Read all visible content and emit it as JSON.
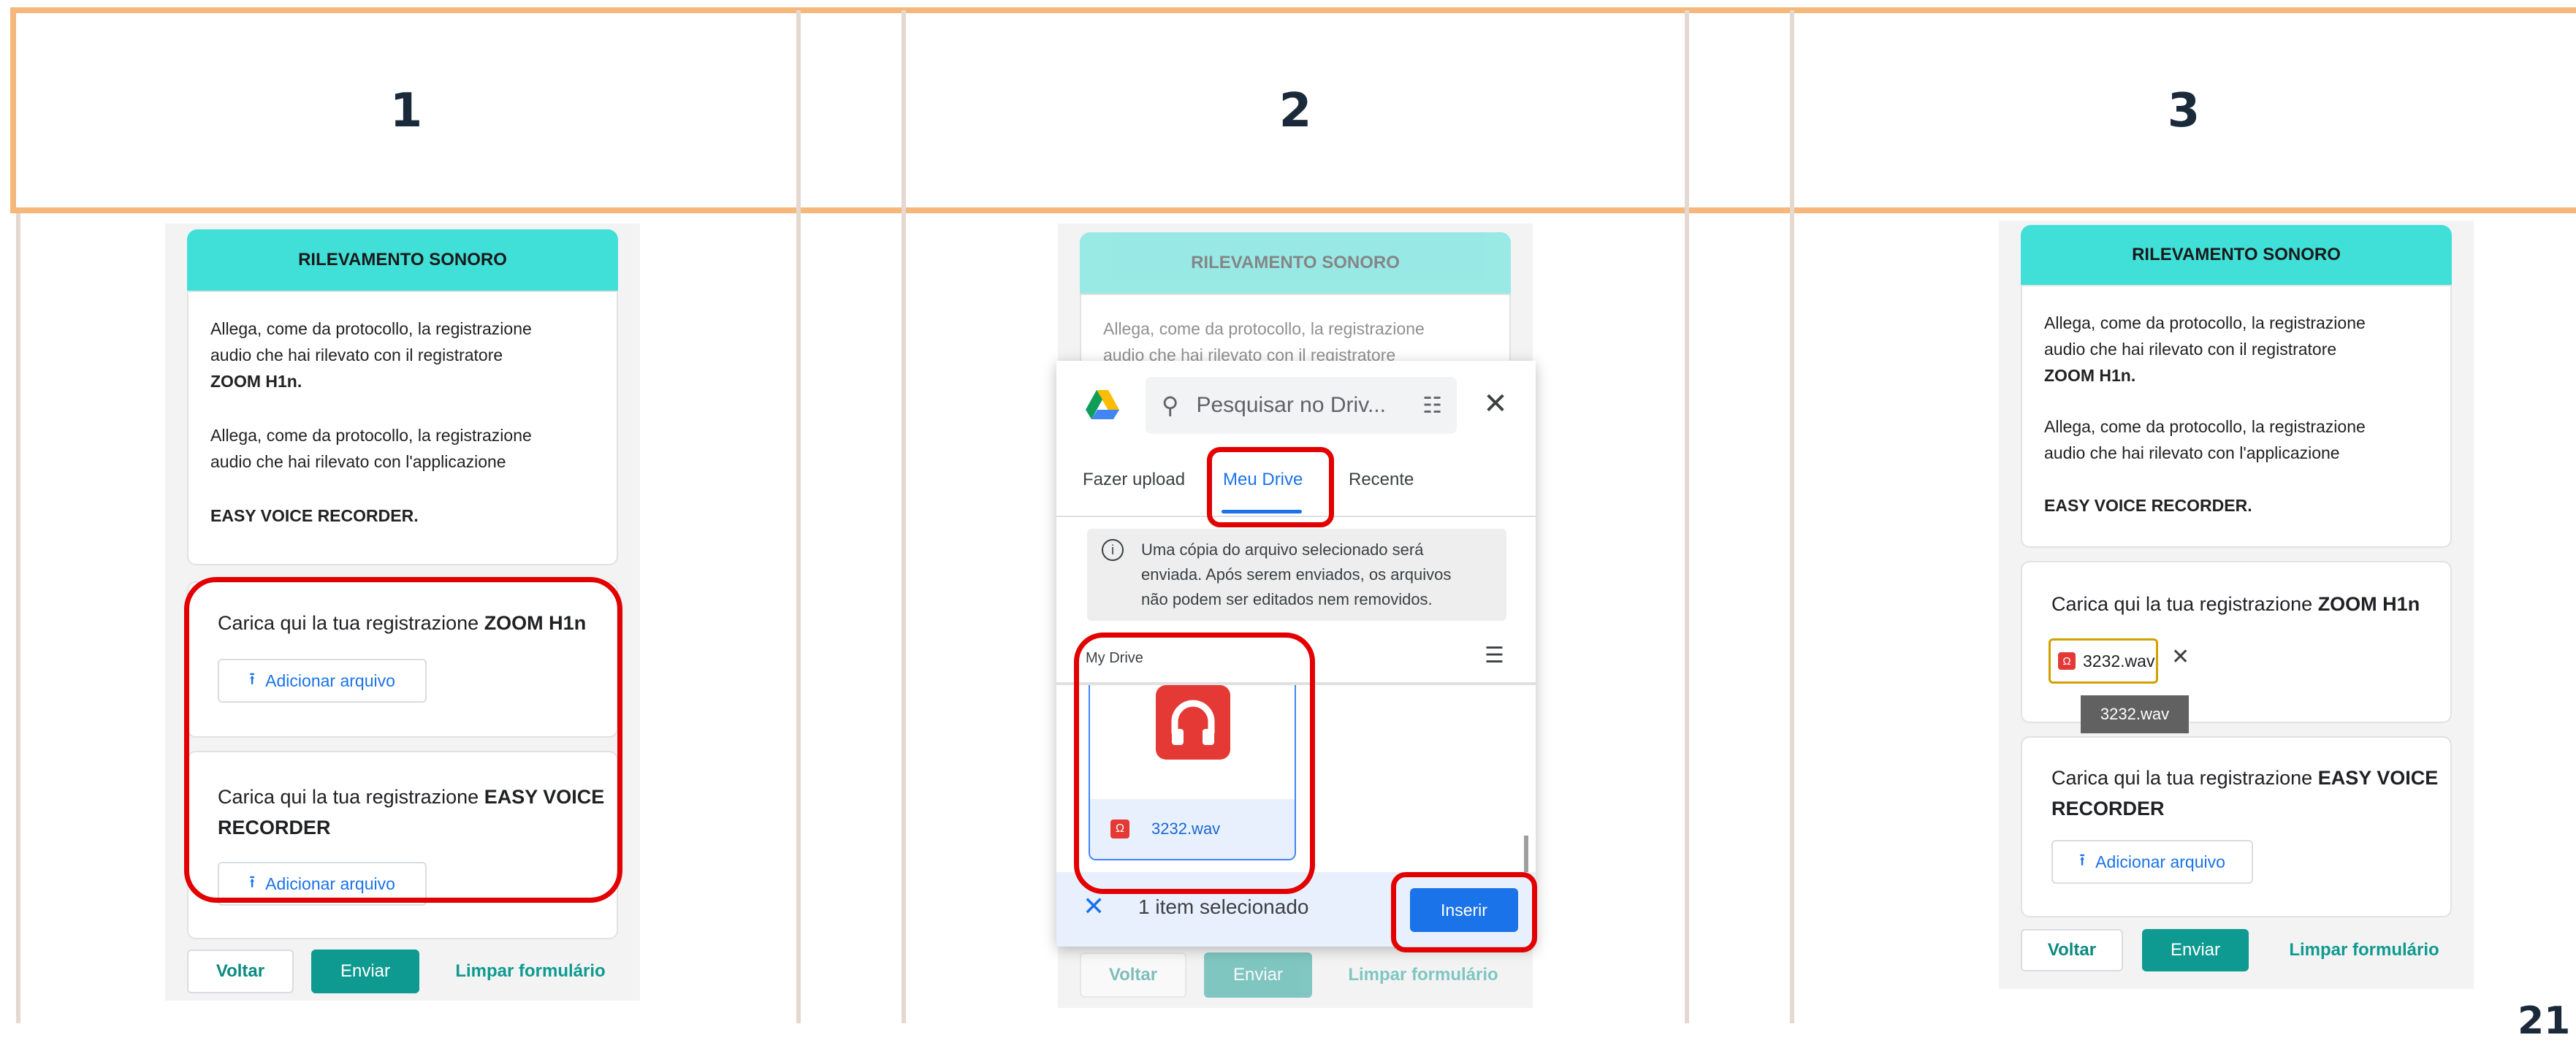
{
  "steps": [
    "1",
    "2",
    "3"
  ],
  "page_number": "21",
  "form": {
    "banner_title": "RILEVAMENTO SONORO",
    "intro_1a": "Allega, come da protocollo, la registrazione",
    "intro_1b": "audio che hai rilevato con il registratore",
    "intro_1c": "ZOOM H1n.",
    "intro_2a": "Allega, come da protocollo, la registrazione",
    "intro_2b": "audio che hai rilevato con l'applicazione",
    "intro_2c": "EASY VOICE RECORDER.",
    "upload_zoom_prefix": "Carica qui la tua registrazione ",
    "upload_zoom_bold": "ZOOM H1n",
    "upload_easy_prefix": "Carica qui la tua registrazione ",
    "upload_easy_bold": "EASY VOICE RECORDER",
    "easy_bold_1": "EASY VOICE",
    "easy_bold_2": "RECORDER",
    "add_file_label": "Adicionar arquivo",
    "back_label": "Voltar",
    "submit_label": "Enviar",
    "clear_label": "Limpar formulário"
  },
  "picker": {
    "search_placeholder": "Pesquisar no Driv...",
    "tabs": [
      "Fazer upload",
      "Meu Drive",
      "Recente"
    ],
    "active_tab": "Meu Drive",
    "info_1": "Uma cópia do arquivo selecionado será",
    "info_2": "enviada. Após serem enviados, os arquivos",
    "info_3": "não podem ser editados nem removidos.",
    "location": "My Drive",
    "file_name": "3232.wav",
    "selection_status": "1 item selecionado",
    "insert_label": "Inserir",
    "blurred_line": "audio che hai rilevato con il registratore"
  },
  "attached": {
    "file_name": "3232.wav",
    "tooltip": "3232.wav"
  },
  "colors": {
    "frame": "#f5b77a",
    "banner": "#40e0d8",
    "teal": "#0e9a90",
    "highlight": "#e30000",
    "drive_blue": "#1a73e8"
  }
}
